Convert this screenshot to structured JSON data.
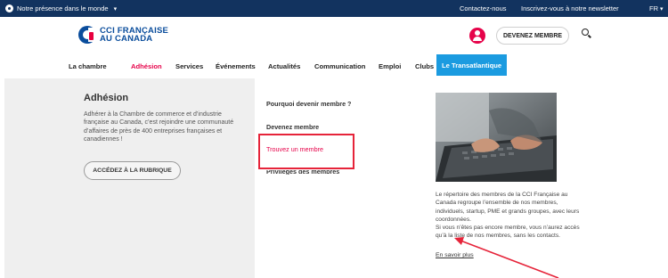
{
  "topbar": {
    "presence": "Notre présence dans le monde",
    "contact": "Contactez-nous",
    "newsletter": "Inscrivez-vous à notre newsletter",
    "language": "FR"
  },
  "logo": {
    "line1": "CCI FRANÇAISE",
    "line2": "AU CANADA"
  },
  "header": {
    "become_member": "DEVENEZ MEMBRE"
  },
  "nav": {
    "items": [
      "La chambre",
      "Adhésion",
      "Services",
      "Événements",
      "Actualités",
      "Communication",
      "Emploi",
      "Clubs",
      "Le Transatlantique"
    ],
    "active": "Adhésion"
  },
  "panel": {
    "title": "Adhésion",
    "description": "Adhérer à la Chambre de commerce et d’industrie française au Canada, c’est rejoindre une communauté d’affaires de près de 400 entreprises françaises et canadiennes !",
    "button": "ACCÉDEZ À LA RUBRIQUE",
    "menu": [
      "Pourquoi devenir membre ?",
      "Devenez membre",
      "Trouvez un membre",
      "Privilèges des membres"
    ],
    "info_lines": [
      "Le répertoire des membres de la CCI Française au",
      "Canada regroupe l’ensemble de nos membres,",
      "individuels, startup, PME et grands groupes, avec leurs",
      "coordonnées.",
      "Si vous n’êtes pas encore membre, vous n’aurez accès",
      "qu’à la liste de nos membres, sans les contacts."
    ],
    "link": "En savoir plus"
  },
  "colors": {
    "navy": "#12335f",
    "accent": "#e6034a",
    "blue": "#1b9be0",
    "annotation": "#e6243a"
  },
  "icons": [
    "globe-icon",
    "chevron-down-icon",
    "user-icon",
    "search-icon"
  ]
}
